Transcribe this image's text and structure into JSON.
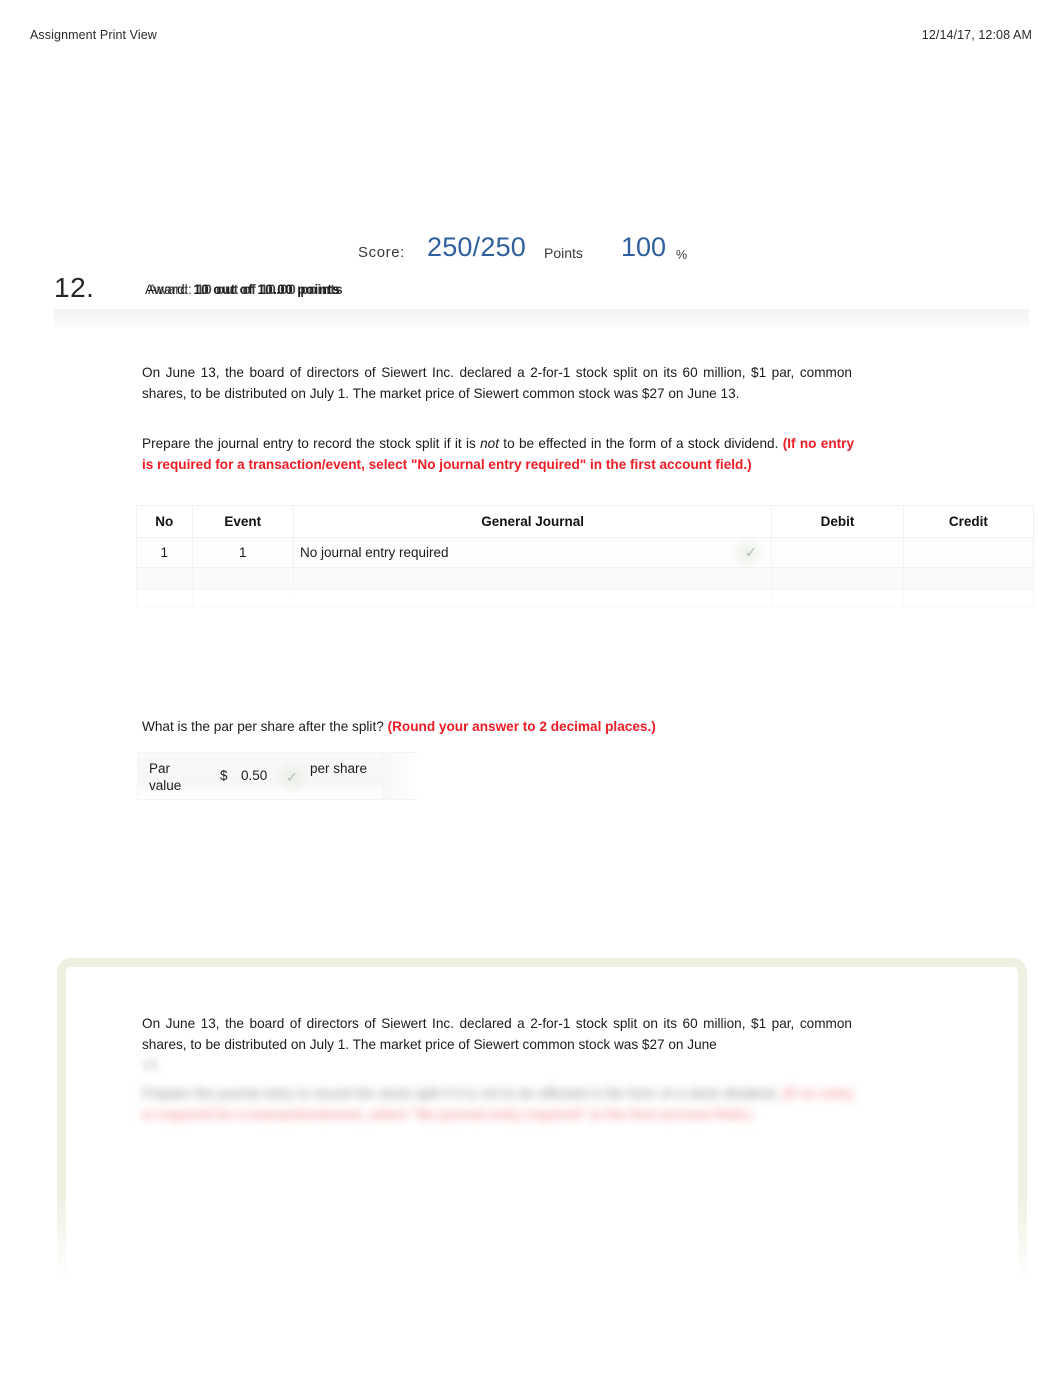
{
  "header": {
    "title": "Assignment Print View",
    "timestamp": "12/14/17, 12:08 AM"
  },
  "score": {
    "label": "Score:",
    "value": "250/250",
    "points_label": "Points",
    "percent": "100",
    "percent_symbol": "%"
  },
  "question": {
    "number": "12.",
    "award": "Award: 10 out of 10.00 points",
    "award_prefix": "Award:",
    "award_value": "10 out of 10.00 points",
    "stem": "On June 13, the board of directors of Siewert Inc. declared a 2-for-1 stock split on its 60 million, $1 par, common shares, to be distributed on July 1. The market price of Siewert common stock was $27 on June 13.",
    "stem_main": "On June 13, the board of directors of Siewert Inc. declared a 2-for-1 stock split on its 60 million, $1 par, common shares, to be distributed on July 1. The market price of Siewert common stock was $27 on June",
    "stem_tail": "13.",
    "prompt_part1": "Prepare the journal entry to record the stock split if it is ",
    "prompt_italic": "not",
    "prompt_part2": " to be effected in the form of a stock dividend. ",
    "prompt_red": "(If no entry is required for a transaction/event, select \"No journal entry required\" in the first account field.)"
  },
  "journal_table": {
    "columns": [
      "No",
      "Event",
      "General Journal",
      "Debit",
      "Credit"
    ],
    "rows": [
      {
        "no": "1",
        "event": "1",
        "general_journal": "No journal entry required",
        "debit": "",
        "credit": "",
        "status_icon": "check-icon"
      }
    ]
  },
  "par": {
    "question_text": "What is the par per share after the split? ",
    "question_red": "(Round your answer to 2 decimal places.)",
    "label": "Par value",
    "currency": "$",
    "value": "0.50",
    "unit": "per share",
    "status_icon": "check-icon"
  },
  "review": {
    "stem_main": "On June 13, the board of directors of Siewert Inc. declared a 2-for-1 stock split on its 60 million, $1 par, common shares, to be distributed on July 1. The market price of Siewert common stock was $27 on June",
    "stem_tail": "13.",
    "prompt_part1": "Prepare the journal entry to record the stock split if it is ",
    "prompt_italic": "not",
    "prompt_part2": " to be effected in the form of a stock dividend. ",
    "prompt_red": "(If no entry is required for a transaction/event, select \"No journal entry required\" in the first account field.)"
  },
  "colors": {
    "accent_blue": "#2f5f9e",
    "alert_red": "#ee1c25",
    "panel_border_green": "#eef1e2",
    "check_green": "#b9c4b3"
  }
}
